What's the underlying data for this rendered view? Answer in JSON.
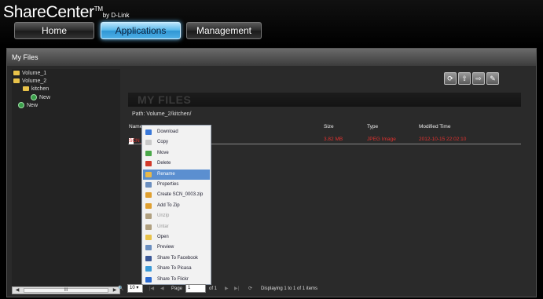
{
  "brand": {
    "name": "ShareCenter",
    "tm": "TM",
    "by": "by D-Link"
  },
  "nav": {
    "home": "Home",
    "applications": "Applications",
    "management": "Management"
  },
  "panel": {
    "title": "My Files"
  },
  "tree": {
    "volume1": "Volume_1",
    "volume2": "Volume_2",
    "kitchen": "kitchen",
    "new_in_kitchen": "New",
    "new_in_volume2": "New",
    "scroll_thumb": "III"
  },
  "main": {
    "banner": "MY FILES",
    "path": "Path: Volume_2/kitchen/",
    "columns": {
      "name": "Name",
      "size": "Size",
      "type": "Type",
      "modified": "Modified Time"
    },
    "row": {
      "name": "SCN_",
      "size": "3.82 MB",
      "type": "JPEG Image",
      "modified": "2012-10-15 22:02:10"
    }
  },
  "context_menu": [
    {
      "label": "Download",
      "icon": "download-icon",
      "state": "normal",
      "color": "#3a78d8"
    },
    {
      "label": "Copy",
      "icon": "copy-icon",
      "state": "normal",
      "color": "#c9c9c9"
    },
    {
      "label": "Move",
      "icon": "move-icon",
      "state": "normal",
      "color": "#4aa84a"
    },
    {
      "label": "Delete",
      "icon": "delete-icon",
      "state": "normal",
      "color": "#d23a2a"
    },
    {
      "label": "Rename",
      "icon": "rename-icon",
      "state": "selected",
      "color": "#e8b84a"
    },
    {
      "label": "Properties",
      "icon": "properties-icon",
      "state": "normal",
      "color": "#6b8fc0"
    },
    {
      "label": "Create  SCN_0003.zip",
      "icon": "zip-icon",
      "state": "normal",
      "color": "#e0a030"
    },
    {
      "label": "Add To Zip",
      "icon": "add-zip-icon",
      "state": "normal",
      "color": "#e0a030"
    },
    {
      "label": "Unzip",
      "icon": "unzip-icon",
      "state": "disabled",
      "color": "#b0a080"
    },
    {
      "label": "Untar",
      "icon": "untar-icon",
      "state": "disabled",
      "color": "#b0a080"
    },
    {
      "label": "Open",
      "icon": "folder-open-icon",
      "state": "normal",
      "color": "#e8c24a"
    },
    {
      "label": "Preview",
      "icon": "preview-icon",
      "state": "normal",
      "color": "#6b8fc0"
    },
    {
      "label": "Share To Facebook",
      "icon": "facebook-icon",
      "state": "normal",
      "color": "#3b5998"
    },
    {
      "label": "Share To Picasa",
      "icon": "picasa-icon",
      "state": "normal",
      "color": "#3a9ad8"
    },
    {
      "label": "Share To Flickr",
      "icon": "flickr-icon",
      "state": "normal",
      "color": "#2a6ad0"
    }
  ],
  "pager": {
    "page_size": "10",
    "page_label": "Page",
    "page_value": "1",
    "of_label": "of 1",
    "status": "Displaying 1 to 1 of 1 items"
  },
  "colors": {
    "accent": "#58b8ea",
    "row_text": "#e2322f",
    "menu_highlight": "#5b8fd0"
  }
}
